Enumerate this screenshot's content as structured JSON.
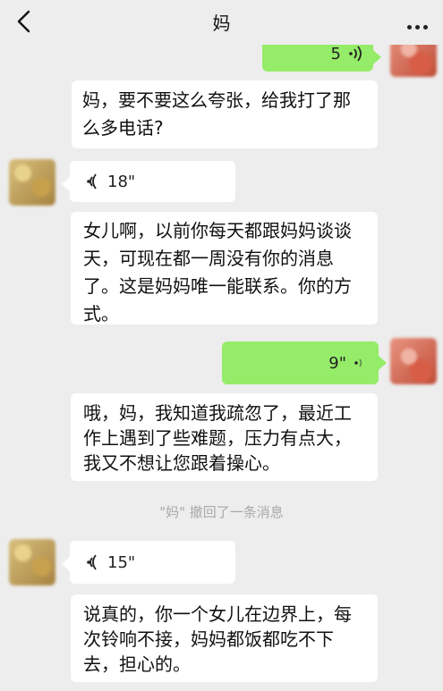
{
  "header": {
    "title": "妈"
  },
  "messages": {
    "m1_duration": "5",
    "m2_text": "妈，要不要这么夸张，给我打了那么多电话?",
    "m3_duration": "18\"",
    "m4_text": "女儿啊，以前你每天都跟妈妈谈谈天，可现在都一周没有你的消息了。这是妈妈唯一能联系。你的方式。",
    "m5_duration": "9\"",
    "m6_text": "哦，妈，我知道我疏忽了，最近工作上遇到了些难题，压力有点大，我又不想让您跟着操心。",
    "system_notice": "\"妈\" 撤回了一条消息",
    "m7_duration": "15\"",
    "m8_text": "说真的，你一个女儿在边界上，每次铃响不接，妈妈都饭都吃不下去，担心的。"
  },
  "icons": {
    "back": "chevron-left-icon",
    "more": "more-dots-icon",
    "voice": "voice-wave-icon"
  },
  "colors": {
    "background": "#ededed",
    "bubble_in": "#ffffff",
    "bubble_out": "#95ec69",
    "system_text": "#a9a9a9"
  }
}
